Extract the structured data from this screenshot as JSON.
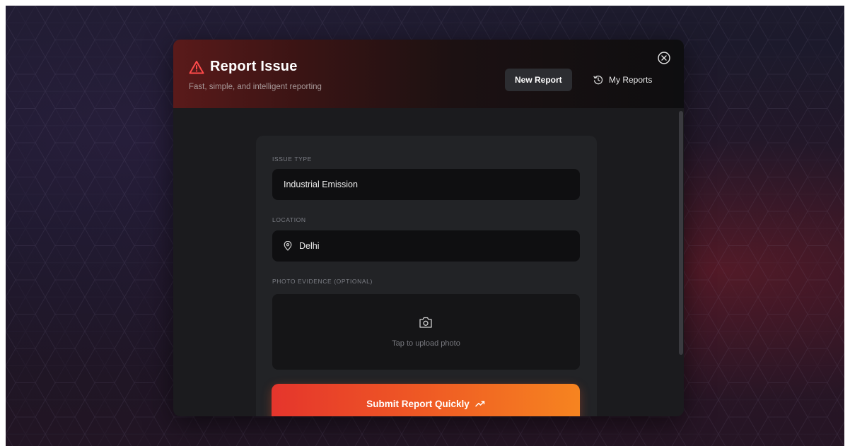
{
  "modal": {
    "title": "Report Issue",
    "subtitle": "Fast, simple, and intelligent reporting",
    "new_report_label": "New Report",
    "my_reports_label": "My Reports"
  },
  "form": {
    "issue_type_label": "ISSUE TYPE",
    "issue_type_value": "Industrial Emission",
    "location_label": "LOCATION",
    "location_value": "Delhi",
    "photo_label": "PHOTO EVIDENCE (OPTIONAL)",
    "upload_text": "Tap to upload photo",
    "submit_label": "Submit Report Quickly"
  },
  "icons": {
    "warning": "warning-triangle-icon",
    "history": "history-icon",
    "close": "close-circle-icon",
    "location": "map-pin-icon",
    "camera": "camera-icon",
    "trend": "trending-up-icon"
  },
  "colors": {
    "accent_start": "#e5352c",
    "accent_end": "#f68420",
    "warning": "#ff4a4a",
    "modal_bg": "#1b1b1e",
    "card_bg": "#222326",
    "field_bg": "#0f0f11"
  }
}
